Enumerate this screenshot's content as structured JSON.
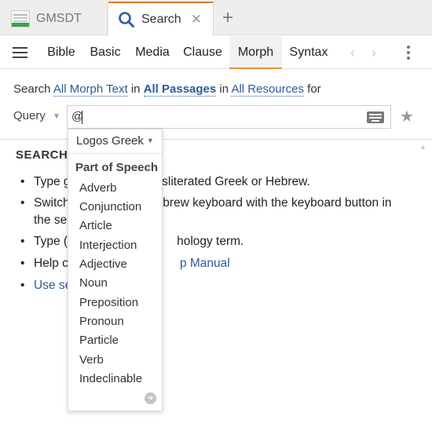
{
  "tabs": {
    "gmsdt": "GMSDT",
    "search": "Search",
    "close_symbol": "✕",
    "new_tab_symbol": "+"
  },
  "menubar": {
    "items": [
      "Bible",
      "Basic",
      "Media",
      "Clause",
      "Morph",
      "Syntax"
    ],
    "active": "Morph",
    "prev_symbol": "‹",
    "next_symbol": "›"
  },
  "searchline": {
    "prefix": "Search",
    "scope": "All Morph Text",
    "in1": "in",
    "passages": "All Passages",
    "in2": "in",
    "resources": "All Resources",
    "suffix": "for"
  },
  "query": {
    "label": "Query",
    "value": "@"
  },
  "content": {
    "title": "SEARCH",
    "bullets": [
      {
        "a": "Type g",
        "b": "nsliterated Greek or Hebrew."
      },
      {
        "a": "Switch",
        "b": "ebrew keyboard with the keyboard button in"
      },
      {
        "a": "the se",
        "b": ""
      },
      {
        "a": "Type (",
        "b": "hology term."
      },
      {
        "a": "Help c",
        "b": "p Manual"
      },
      {
        "a": "Use se",
        "b": ""
      }
    ]
  },
  "dropdown": {
    "language": "Logos Greek",
    "header": "Part of Speech",
    "items": [
      "Adverb",
      "Conjunction",
      "Article",
      "Interjection",
      "Adjective",
      "Noun",
      "Preposition",
      "Pronoun",
      "Particle",
      "Verb",
      "Indeclinable"
    ]
  },
  "icons": {
    "gmsdt_thumb": "document-thumbnail-icon",
    "search": "magnifier-icon",
    "keyboard": "keyboard-icon",
    "favorite": "star-icon",
    "more": "arrow-circle-icon"
  },
  "colors": {
    "active_tab_accent": "#e8742a",
    "link": "#2a5b9a"
  }
}
